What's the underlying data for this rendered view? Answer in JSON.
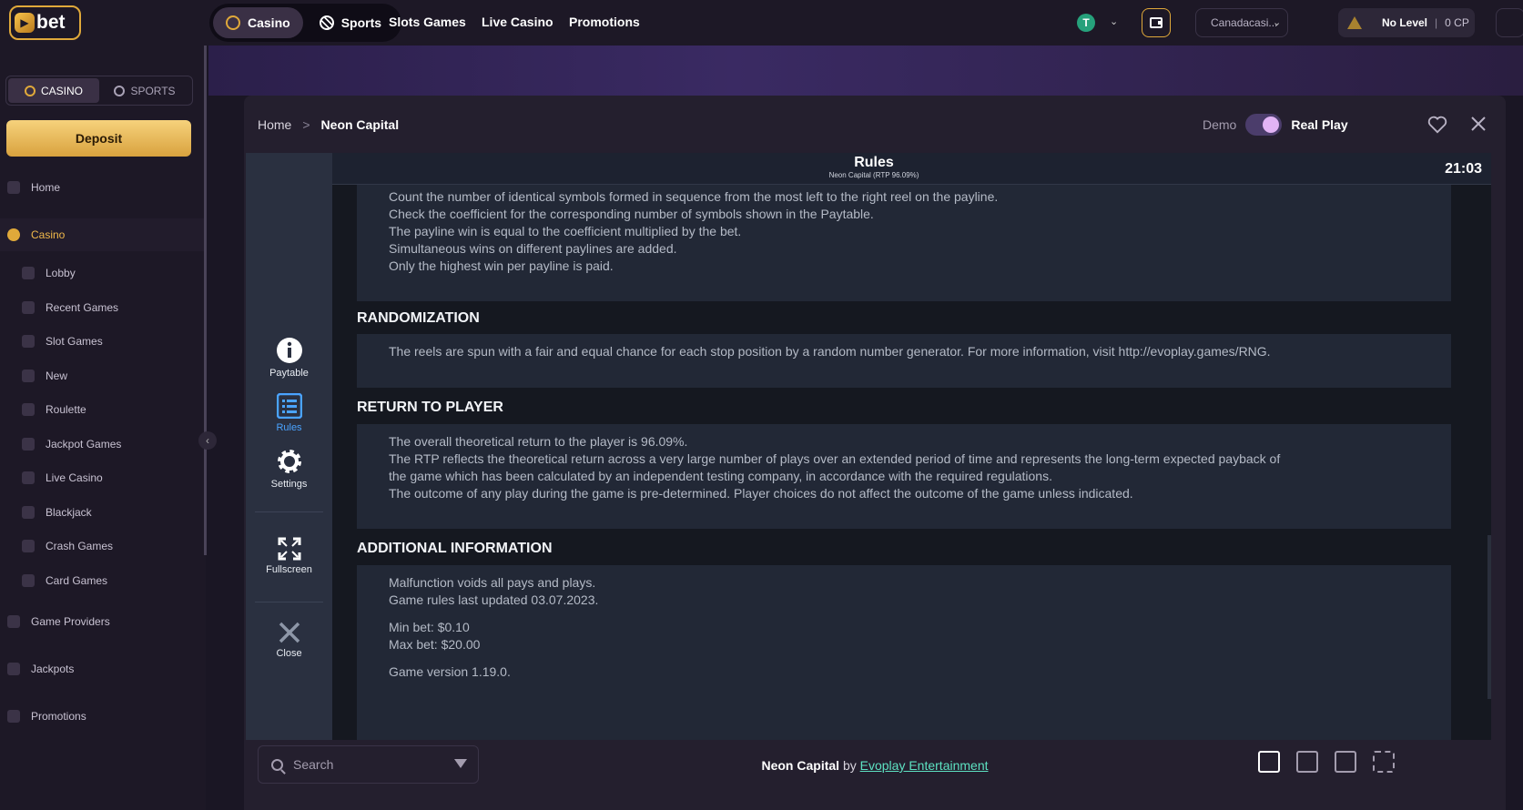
{
  "header": {
    "logo_text": "bet",
    "mode_tabs": [
      "Casino",
      "Sports"
    ],
    "nav": [
      "Slots Games",
      "Live Casino",
      "Promotions"
    ],
    "currency_icon": "tether-icon",
    "currency_symbol": "T",
    "lang_select": "Canadacasi...",
    "level": "No Level",
    "cp": "0 CP",
    "level_sep": "|"
  },
  "sidebar": {
    "tabs": [
      "CASINO",
      "SPORTS"
    ],
    "deposit": "Deposit",
    "items": [
      {
        "label": "Home",
        "kind": "top"
      },
      {
        "label": "Casino",
        "kind": "top"
      },
      {
        "label": "Lobby",
        "kind": "sub"
      },
      {
        "label": "Recent Games",
        "kind": "sub"
      },
      {
        "label": "Slot Games",
        "kind": "sub"
      },
      {
        "label": "New",
        "kind": "sub"
      },
      {
        "label": "Roulette",
        "kind": "sub"
      },
      {
        "label": "Jackpot Games",
        "kind": "sub"
      },
      {
        "label": "Live Casino",
        "kind": "sub"
      },
      {
        "label": "Blackjack",
        "kind": "sub"
      },
      {
        "label": "Crash Games",
        "kind": "sub"
      },
      {
        "label": "Card Games",
        "kind": "sub"
      },
      {
        "label": "Game Providers",
        "kind": "top"
      },
      {
        "label": "Jackpots",
        "kind": "top"
      },
      {
        "label": "Promotions",
        "kind": "top"
      }
    ]
  },
  "modal": {
    "breadcrumb_home": "Home",
    "breadcrumb_sep": ">",
    "breadcrumb_current": "Neon Capital",
    "demo_label": "Demo",
    "real_label": "Real Play"
  },
  "game": {
    "title": "Rules",
    "subtitle": "Neon Capital (RTP 96.09%)",
    "time": "21:03",
    "left_menu": [
      "Paytable",
      "Rules",
      "Settings",
      "Fullscreen",
      "Close"
    ],
    "sections": [
      {
        "heading": "",
        "lines": [
          "Count the number of identical symbols formed in sequence from the most left to the right reel on the payline.",
          "Check the coefficient for the corresponding number of symbols shown in the Paytable.",
          "The payline win is equal to the coefficient multiplied by the bet.",
          "Simultaneous wins on different paylines are added.",
          "Only the highest win per payline is paid."
        ]
      },
      {
        "heading": "RANDOMIZATION",
        "lines": [
          "The reels are spun with a fair and equal chance for each stop position by a random number generator. For more information, visit http://evoplay.games/RNG."
        ]
      },
      {
        "heading": "RETURN TO PLAYER",
        "lines": [
          "The overall theoretical return to the player is 96.09%.",
          "The RTP reflects the theoretical return across a very large number of plays over an extended period of time and represents the long-term expected payback of",
          "the game which has been calculated by an independent testing company, in accordance with the required regulations.",
          "The outcome of any play during the game is pre-determined. Player choices do not affect the outcome of the game unless indicated."
        ]
      },
      {
        "heading": "ADDITIONAL INFORMATION",
        "lines": [
          "Malfunction voids all pays and plays.",
          "Game rules last updated 03.07.2023.",
          "",
          "Min bet: $0.10",
          "Max bet: $20.00",
          "",
          "Game version 1.19.0."
        ]
      }
    ]
  },
  "bottom": {
    "search_placeholder": "Search",
    "game_name": "Neon Capital",
    "by": "by",
    "provider": "Evoplay Entertainment"
  }
}
